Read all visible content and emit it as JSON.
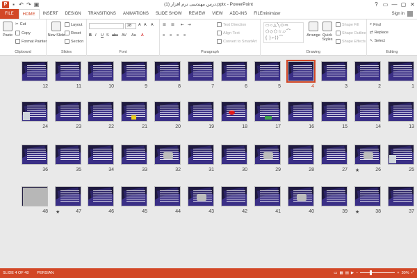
{
  "window": {
    "title": "درس مهندسی نرم افزار (1).pptx - PowerPoint",
    "app_icon": "P",
    "controls": [
      "?",
      "▭",
      "—",
      "▢",
      "✕"
    ]
  },
  "tabs": [
    "FILE",
    "HOME",
    "INSERT",
    "DESIGN",
    "TRANSITIONS",
    "ANIMATIONS",
    "SLIDE SHOW",
    "REVIEW",
    "VIEW",
    "ADD-INS",
    "FILEminimizer"
  ],
  "active_tab": "HOME",
  "signin": "Sign in",
  "ribbon": {
    "clipboard": {
      "label": "Clipboard",
      "paste": "Paste",
      "cut": "Cut",
      "copy": "Copy",
      "format_painter": "Format Painter"
    },
    "slides": {
      "label": "Slides",
      "new_slide": "New Slide",
      "layout": "Layout",
      "reset": "Reset",
      "section": "Section"
    },
    "font": {
      "label": "Font",
      "size": "28",
      "increase": "A",
      "decrease": "A",
      "clear": "A",
      "bold": "B",
      "italic": "I",
      "underline": "U",
      "shadow": "S",
      "strike": "abc",
      "spacing": "AV",
      "case": "Aa",
      "color": "A"
    },
    "paragraph": {
      "label": "Paragraph",
      "text_direction": "Text Direction",
      "align_text": "Align Text",
      "convert_smartart": "Convert to SmartArt"
    },
    "drawing": {
      "label": "Drawing",
      "arrange": "Arrange",
      "quick_styles": "Quick Styles",
      "shape_fill": "Shape Fill",
      "shape_outline": "Shape Outline",
      "shape_effects": "Shape Effects"
    },
    "editing": {
      "label": "Editing",
      "find": "Find",
      "replace": "Replace",
      "select": "Select"
    }
  },
  "slides": [
    {
      "n": "12"
    },
    {
      "n": "11"
    },
    {
      "n": "10"
    },
    {
      "n": "9"
    },
    {
      "n": "8"
    },
    {
      "n": "7"
    },
    {
      "n": "6"
    },
    {
      "n": "5"
    },
    {
      "n": "4",
      "selected": true
    },
    {
      "n": "3"
    },
    {
      "n": "2"
    },
    {
      "n": "1"
    },
    {
      "n": "24",
      "pic": "photo-small"
    },
    {
      "n": "23"
    },
    {
      "n": "22"
    },
    {
      "n": "21",
      "pic": "yellow"
    },
    {
      "n": "20"
    },
    {
      "n": "19"
    },
    {
      "n": "18",
      "pic": "red"
    },
    {
      "n": "17",
      "pic": "green"
    },
    {
      "n": "16"
    },
    {
      "n": "15"
    },
    {
      "n": "14"
    },
    {
      "n": "13"
    },
    {
      "n": "36"
    },
    {
      "n": "35"
    },
    {
      "n": "34"
    },
    {
      "n": "33"
    },
    {
      "n": "32",
      "pic": "chip"
    },
    {
      "n": "31"
    },
    {
      "n": "30"
    },
    {
      "n": "29",
      "pic": "chip"
    },
    {
      "n": "28"
    },
    {
      "n": "27"
    },
    {
      "n": "26",
      "pic": "chip",
      "star": true
    },
    {
      "n": "25",
      "pic": "photo-small"
    },
    {
      "n": "48",
      "pic": "photo"
    },
    {
      "n": "47",
      "star": true
    },
    {
      "n": "46"
    },
    {
      "n": "45"
    },
    {
      "n": "44"
    },
    {
      "n": "43",
      "pic": "chip"
    },
    {
      "n": "42"
    },
    {
      "n": "41"
    },
    {
      "n": "40",
      "pic": "chip"
    },
    {
      "n": "39"
    },
    {
      "n": "38",
      "star": true
    },
    {
      "n": "37"
    }
  ],
  "status": {
    "slide": "SLIDE 4 OF 48",
    "language": "PERSIAN",
    "zoom": "30%",
    "zoom_level_fraction": 0.3
  },
  "colors": {
    "accent": "#d24726",
    "slide_bg": "#1f1a3f"
  }
}
